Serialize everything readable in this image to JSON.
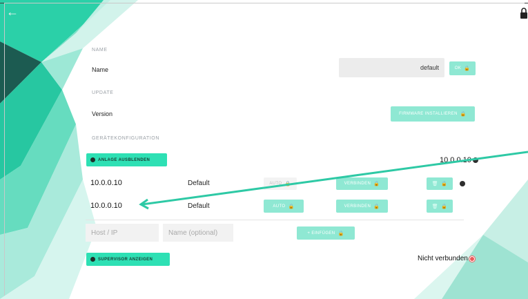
{
  "nav": {
    "back_icon": "arrow-left-icon",
    "lock_icon": "lock-icon"
  },
  "name_section": {
    "heading": "NAME",
    "label": "Name",
    "value": "default",
    "ok_label": "OK"
  },
  "update_section": {
    "heading": "UPDATE",
    "label": "Version",
    "install_label": "FIRMWARE INSTALLIEREN"
  },
  "config_section": {
    "heading": "GERÄTEKONFIGURATION",
    "hide_button": "ANLAGE AUSBLENDEN",
    "current_ip": "10.0.0.10",
    "rows": [
      {
        "ip": "10.0.0.10",
        "name": "Default",
        "auto": "AUTO",
        "connect": "VERBINDEN"
      },
      {
        "ip": "10.0.0.10",
        "name": "Default",
        "auto": "AUTO",
        "connect": "VERBINDEN"
      }
    ],
    "host_placeholder": "Host / IP",
    "name_placeholder": "Name (optional)",
    "add_button": "+ EINFÜGEN"
  },
  "supervisor": {
    "button": "SUPERVISOR ANZEIGEN",
    "status": "Nicht verbunden"
  },
  "colors": {
    "accent": "#2ee0b4",
    "accent_light": "#8fe8d3",
    "dark_teal": "#1f6b5e",
    "status_red": "#ea5a5a"
  }
}
